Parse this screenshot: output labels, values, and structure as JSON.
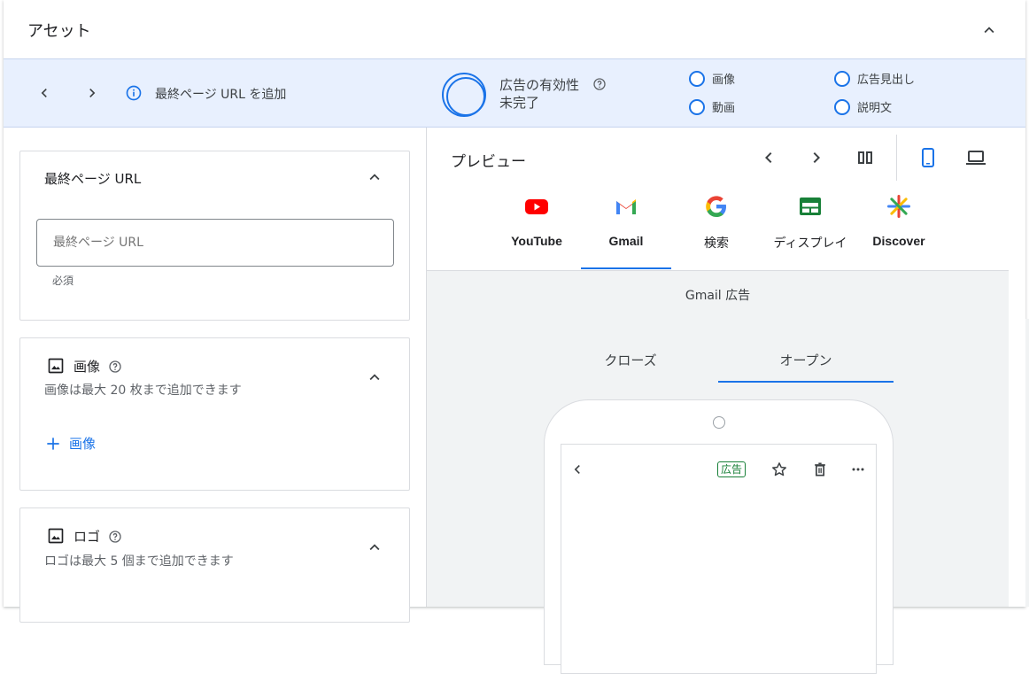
{
  "header": {
    "title": "アセット"
  },
  "info_bar": {
    "message": "最終ページ URL を追加",
    "effectiveness_label": "広告の有効性",
    "effectiveness_status": "未完了",
    "requirements": [
      "画像",
      "動画",
      "広告見出し",
      "説明文"
    ]
  },
  "final_url_card": {
    "title": "最終ページ URL",
    "placeholder": "最終ページ URL",
    "hint": "必須"
  },
  "images_card": {
    "title": "画像",
    "subtitle": "画像は最大 20 枚まで追加できます",
    "add_label": "画像"
  },
  "logo_card": {
    "title": "ロゴ",
    "subtitle": "ロゴは最大 5 個まで追加できます"
  },
  "preview": {
    "title": "プレビュー",
    "channels": [
      "YouTube",
      "Gmail",
      "検索",
      "ディスプレイ",
      "Discover"
    ],
    "selected_channel": "Gmail",
    "area_label": "Gmail 広告",
    "state_tabs": [
      "クローズ",
      "オープン"
    ],
    "selected_state": "オープン",
    "ad_badge": "広告"
  },
  "colors": {
    "accent": "#1a73e8",
    "info_bar_bg": "#e8f0fe",
    "ad_badge": "#188038"
  },
  "icons": [
    "chevron-up-icon",
    "chevron-left-icon",
    "chevron-right-icon",
    "info-icon",
    "help-icon",
    "image-icon",
    "plus-icon",
    "columns-icon",
    "mobile-icon",
    "laptop-icon",
    "youtube-icon",
    "gmail-icon",
    "google-icon",
    "display-icon",
    "discover-icon",
    "star-icon",
    "trash-icon",
    "more-icon",
    "back-icon"
  ]
}
